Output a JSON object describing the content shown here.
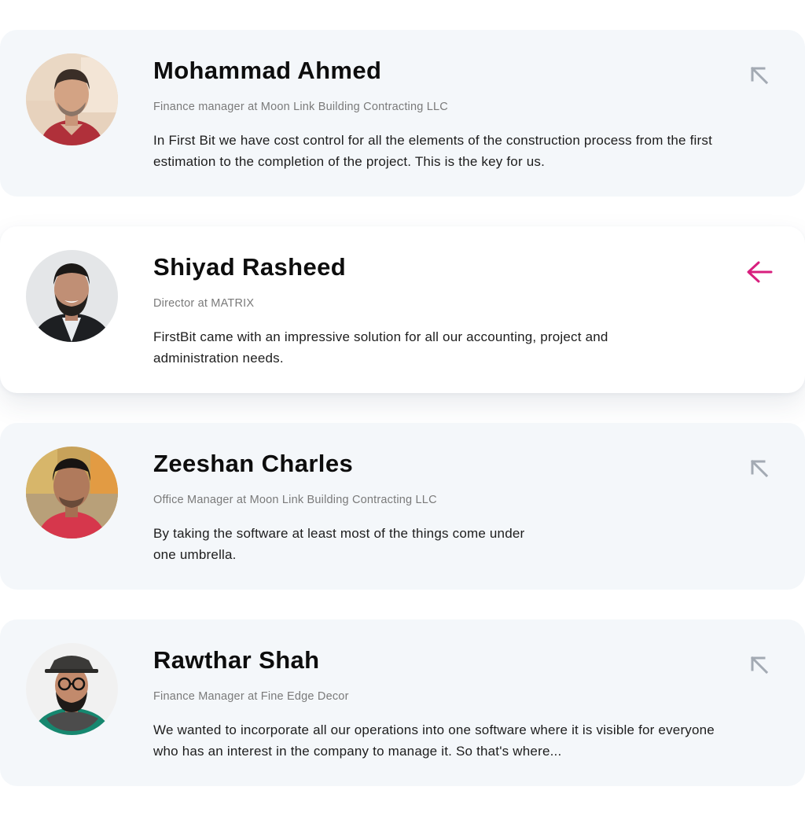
{
  "colors": {
    "card_background": "#f4f7fa",
    "active_card_background": "#ffffff",
    "arrow_muted": "#a3aab3",
    "arrow_active": "#d81f7e",
    "role_text": "#7a7a7a"
  },
  "testimonials": [
    {
      "name": "Mohammad Ahmed",
      "role": "Finance manager at Moon Link Building Contracting LLC",
      "quote": "In First Bit we have cost control for all the elements of the construction process from the first estimation to the completion of the project. This is the key for us.",
      "arrow_icon": "arrow-up-left-icon",
      "active": false
    },
    {
      "name": "Shiyad Rasheed",
      "role": "Director at MATRIX",
      "quote": "FirstBit came with an impressive solution for all our accounting, project and administration needs.",
      "arrow_icon": "arrow-left-icon",
      "active": true
    },
    {
      "name": "Zeeshan Charles",
      "role": "Office Manager at Moon Link Building Contracting LLC",
      "quote": "By taking the software at least most of the things come under one umbrella.",
      "arrow_icon": "arrow-up-left-icon",
      "active": false
    },
    {
      "name": "Rawthar Shah",
      "role": "Finance Manager at Fine Edge Decor",
      "quote": "We wanted to incorporate all our operations into one software where it is visible for everyone who has an interest in the company to manage it. So that's where...",
      "arrow_icon": "arrow-up-left-icon",
      "active": false
    }
  ]
}
